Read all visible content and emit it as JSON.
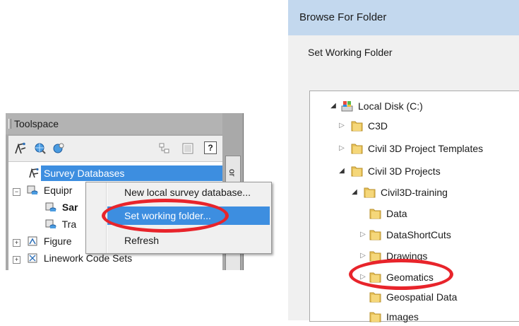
{
  "toolspace": {
    "title": "Toolspace",
    "side_tab": "or",
    "tree": {
      "survey_databases": "Survey Databases",
      "equipment": "Equipr",
      "sample": "Sar",
      "trav": "Tra",
      "figure": "Figure",
      "linework": "Linework Code Sets"
    }
  },
  "context_menu": {
    "items": [
      "New local survey database...",
      "Set working folder...",
      "Refresh"
    ],
    "highlighted_index": 1
  },
  "dialog": {
    "title": "Browse For Folder",
    "description": "Set Working Folder",
    "tree": {
      "local_disk": "Local Disk (C:)",
      "c3d": "C3D",
      "templates": "Civil 3D Project Templates",
      "projects": "Civil 3D Projects",
      "training": "Civil3D-training",
      "data": "Data",
      "shortcuts": "DataShortCuts",
      "drawings": "Drawings",
      "geomatics": "Geomatics",
      "geospatial": "Geospatial Data",
      "images": "Images"
    }
  },
  "colors": {
    "selection": "#3d8ee0",
    "highlight_oval": "#e8242b",
    "folder": "#e8c25a",
    "dialog_title_bar": "#c3d8ee"
  }
}
